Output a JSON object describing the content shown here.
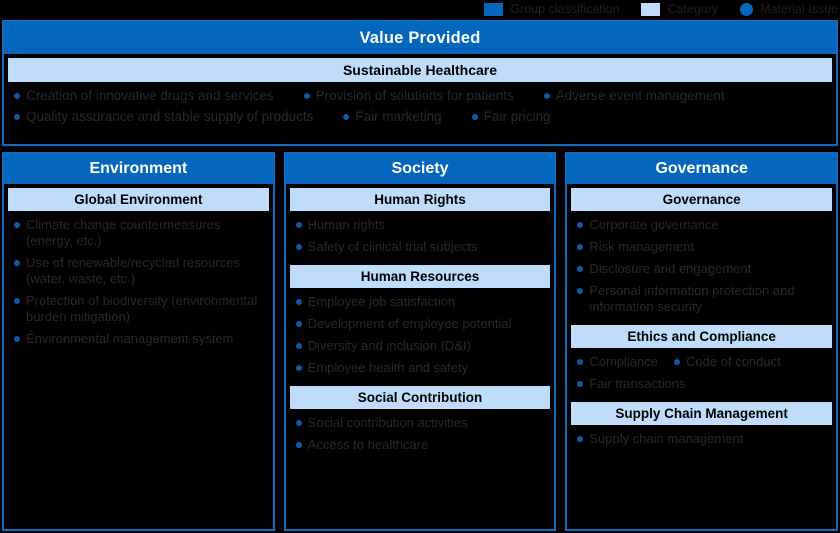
{
  "colors": {
    "header_blue": "#0466bd",
    "light_blue": "#bfdcfb",
    "border_blue": "#0b6ec4",
    "bullet_blue": "#1157a5",
    "background": "#000000",
    "header_text": "#ffffff",
    "body_text": "#2d2723"
  },
  "legend": {
    "items": [
      {
        "icon": "square-blue-icon",
        "label": "Group classification"
      },
      {
        "icon": "square-lightblue-icon",
        "label": "Category"
      },
      {
        "icon": "circle-blue-icon",
        "label": "Material Issue"
      }
    ]
  },
  "value_provided": {
    "title": "Value Provided",
    "category": "Sustainable Healthcare",
    "rows": [
      [
        "Creation of innovative drugs and services",
        "Provision of solutions for patients",
        "Adverse event management"
      ],
      [
        "Quality assurance and stable supply of products",
        "Fair marketing",
        "Fair pricing"
      ]
    ]
  },
  "columns": [
    {
      "title": "Environment",
      "groups": [
        {
          "category": "Global Environment",
          "inline": false,
          "items": [
            "Climate change countermeasures (energy, etc.)",
            "Use of renewable/recycled resources (water, waste, etc.)",
            "Protection of biodiversity (environmental burden mitigation)",
            "Environmental management system"
          ]
        }
      ]
    },
    {
      "title": "Society",
      "groups": [
        {
          "category": "Human Rights",
          "inline": false,
          "items": [
            "Human rights",
            "Safety of clinical trial subjects"
          ]
        },
        {
          "category": "Human Resources",
          "inline": false,
          "items": [
            "Employee job satisfaction",
            "Development of employee potential",
            "Diversity and inclusion (D&I)",
            "Employee health and safety"
          ]
        },
        {
          "category": "Social Contribution",
          "inline": false,
          "items": [
            "Social contribution activities",
            "Access to healthcare"
          ]
        }
      ]
    },
    {
      "title": "Governance",
      "groups": [
        {
          "category": "Governance",
          "inline": false,
          "items": [
            "Corporate governance",
            "Risk management",
            "Disclosure and engagement",
            "Personal information protection and information security"
          ]
        },
        {
          "category": "Ethics and Compliance",
          "inline": true,
          "items": [
            "Compliance",
            "Code of conduct",
            "Fair transactions"
          ]
        },
        {
          "category": "Supply Chain Management",
          "inline": false,
          "items": [
            "Supply chain management"
          ]
        }
      ]
    }
  ]
}
